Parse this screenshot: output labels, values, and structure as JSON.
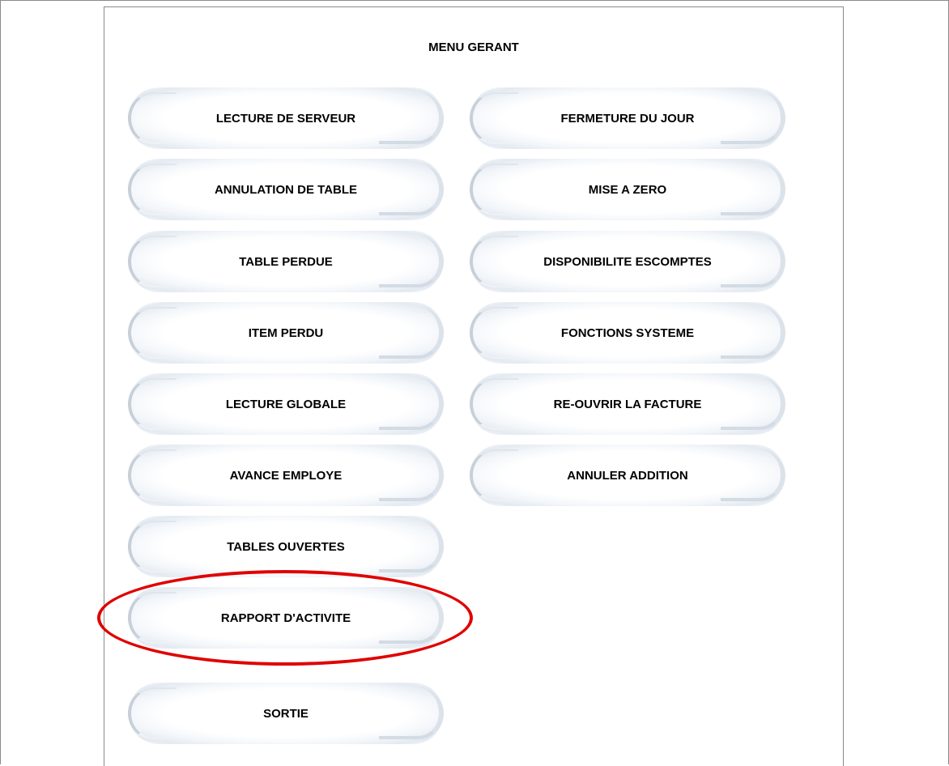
{
  "menu": {
    "title": "MENU GERANT",
    "left": [
      "LECTURE DE SERVEUR",
      "ANNULATION DE TABLE",
      "TABLE PERDUE",
      "ITEM PERDU",
      "LECTURE GLOBALE",
      "AVANCE EMPLOYE",
      "TABLES OUVERTES",
      "RAPPORT D'ACTIVITE",
      "SORTIE"
    ],
    "right": [
      "FERMETURE DU JOUR",
      "MISE A ZERO",
      "DISPONIBILITE ESCOMPTES",
      "FONCTIONS SYSTEME",
      "RE-OUVRIR LA FACTURE",
      "ANNULER ADDITION"
    ]
  },
  "colors": {
    "highlight": "#e00000"
  }
}
